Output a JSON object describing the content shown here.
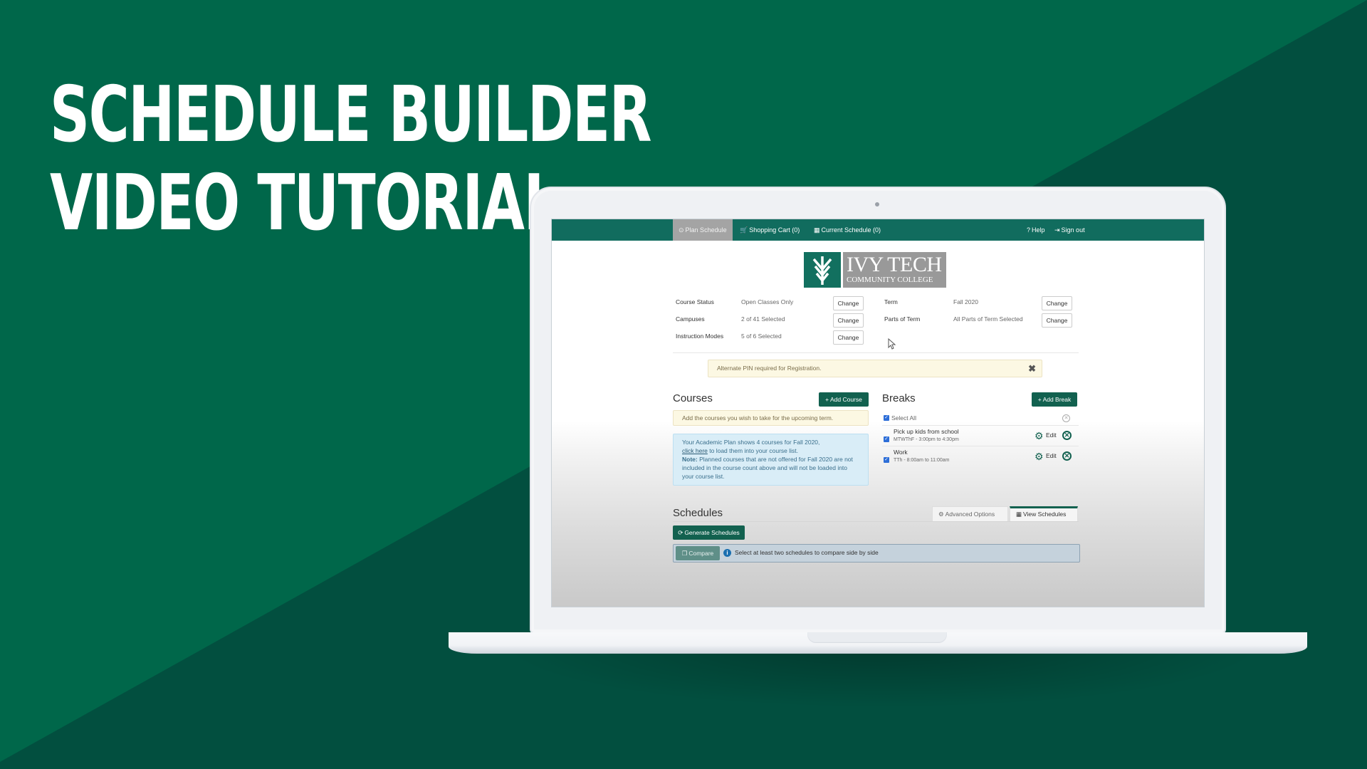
{
  "banner": {
    "title_line1": "SCHEDULE BUILDER",
    "title_line2": "VIDEO TUTORIAL",
    "colors": {
      "background_light": "#00674a",
      "background_dark": "#024f3f",
      "nav_green": "#116c5e",
      "button_green": "#12614f"
    }
  },
  "nav": {
    "items": [
      {
        "label": "Plan Schedule",
        "icon": "clock-icon",
        "active": true
      },
      {
        "label": "Shopping Cart (0)",
        "icon": "cart-icon"
      },
      {
        "label": "Current Schedule (0)",
        "icon": "calendar-icon"
      }
    ],
    "right": [
      {
        "label": "Help",
        "icon": "question-circle-icon"
      },
      {
        "label": "Sign out",
        "icon": "sign-out-icon"
      }
    ]
  },
  "logo": {
    "name": "IVY TECH",
    "subtitle": "COMMUNITY COLLEGE"
  },
  "options": {
    "left": [
      {
        "label": "Course Status",
        "value": "Open Classes Only",
        "button": "Change"
      },
      {
        "label": "Campuses",
        "value": "2 of 41 Selected",
        "button": "Change"
      },
      {
        "label": "Instruction Modes",
        "value": "5 of 6 Selected",
        "button": "Change"
      }
    ],
    "right": [
      {
        "label": "Term",
        "value": "Fall 2020",
        "button": "Change"
      },
      {
        "label": "Parts of Term",
        "value": "All Parts of Term Selected",
        "button": "Change"
      }
    ]
  },
  "alert": {
    "text": "Alternate PIN required for Registration.",
    "close": "✖"
  },
  "courses": {
    "heading": "Courses",
    "add_button": "+ Add Course",
    "hint": "Add the courses you wish to take for the upcoming term.",
    "plan_notice": {
      "line1": "Your Academic Plan shows 4 courses for Fall 2020,",
      "link": "click here",
      "line2": " to load them into your course list.",
      "note_label": "Note:",
      "note_text": " Planned courses that are not offered for Fall 2020 are not included in the course count above and will not be loaded into your course list."
    }
  },
  "breaks": {
    "heading": "Breaks",
    "add_button": "+ Add Break",
    "select_all": "Select All",
    "items": [
      {
        "title": "Pick up kids from school",
        "time": "MTWThF - 3:00pm to 4:30pm",
        "edit": "Edit",
        "checked": true
      },
      {
        "title": "Work",
        "time": "TTh - 8:00am to 11:00am",
        "edit": "Edit",
        "checked": true
      }
    ]
  },
  "schedules": {
    "heading": "Schedules",
    "tabs": [
      {
        "label": "Advanced Options",
        "icon": "cogs-icon"
      },
      {
        "label": "View Schedules",
        "icon": "calendar-icon",
        "active": true
      }
    ],
    "generate_button": "Generate Schedules",
    "compare_button": "Compare",
    "compare_hint": "Select at least two schedules to compare side by side"
  }
}
